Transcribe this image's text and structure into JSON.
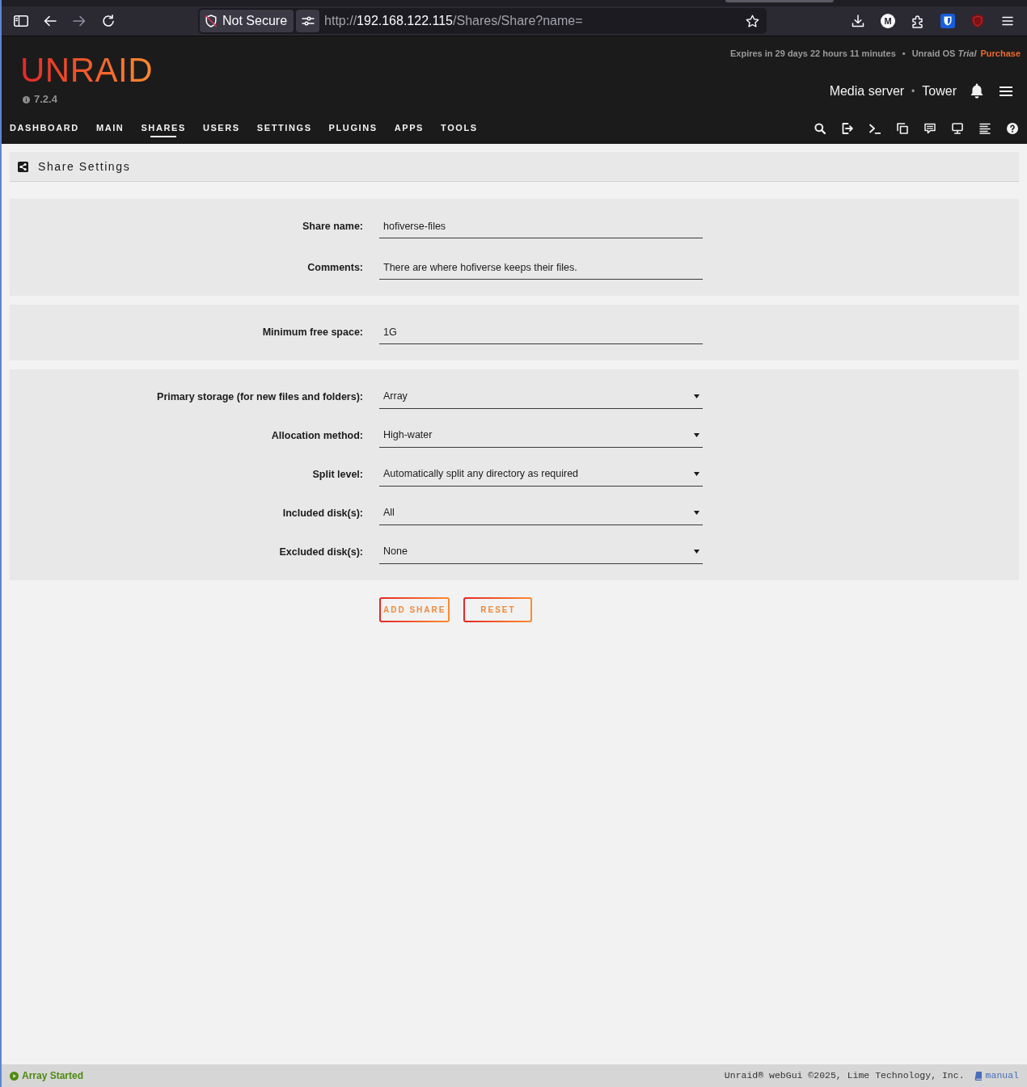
{
  "browser": {
    "security_label": "Not Secure",
    "url": {
      "scheme": "http://",
      "host": "192.168.122.115",
      "path": "/Shares/Share?name="
    },
    "back_disabled": false,
    "forward_disabled": true,
    "extension_badge": "M"
  },
  "header": {
    "logo": "UNRAID",
    "version": "7.2.4",
    "license": {
      "expiry": "Expires in 29 days 22 hours 11 minutes",
      "separator": "•",
      "product": "Unraid OS",
      "edition": "Trial",
      "action": "Purchase"
    },
    "server": {
      "description": "Media server",
      "separator": "•",
      "name": "Tower"
    }
  },
  "nav": {
    "tabs": [
      {
        "label": "DASHBOARD",
        "selected": false
      },
      {
        "label": "MAIN",
        "selected": false
      },
      {
        "label": "SHARES",
        "selected": true
      },
      {
        "label": "USERS",
        "selected": false
      },
      {
        "label": "SETTINGS",
        "selected": false
      },
      {
        "label": "PLUGINS",
        "selected": false
      },
      {
        "label": "APPS",
        "selected": false
      },
      {
        "label": "TOOLS",
        "selected": false
      }
    ]
  },
  "panel": {
    "title": "Share Settings"
  },
  "sections": [
    {
      "fields": [
        {
          "kind": "text",
          "label": "Share name:",
          "value": "hofiverse-files"
        },
        {
          "kind": "text",
          "label": "Comments:",
          "value": "There are where hofiverse keeps their files."
        }
      ]
    },
    {
      "fields": [
        {
          "kind": "text",
          "label": "Minimum free space:",
          "value": "1G"
        }
      ]
    },
    {
      "fields": [
        {
          "kind": "select",
          "label": "Primary storage (for new files and folders):",
          "value": "Array"
        },
        {
          "kind": "select",
          "label": "Allocation method:",
          "value": "High-water"
        },
        {
          "kind": "select",
          "label": "Split level:",
          "value": "Automatically split any directory as required"
        },
        {
          "kind": "select",
          "label": "Included disk(s):",
          "value": "All"
        },
        {
          "kind": "select",
          "label": "Excluded disk(s):",
          "value": "None"
        }
      ]
    }
  ],
  "buttons": [
    {
      "label": "ADD SHARE"
    },
    {
      "label": "RESET"
    }
  ],
  "status_bar": {
    "array_status": "Array Started",
    "copyright": "Unraid® webGui ©2025, Lime Technology, Inc.",
    "manual_link": "manual"
  }
}
